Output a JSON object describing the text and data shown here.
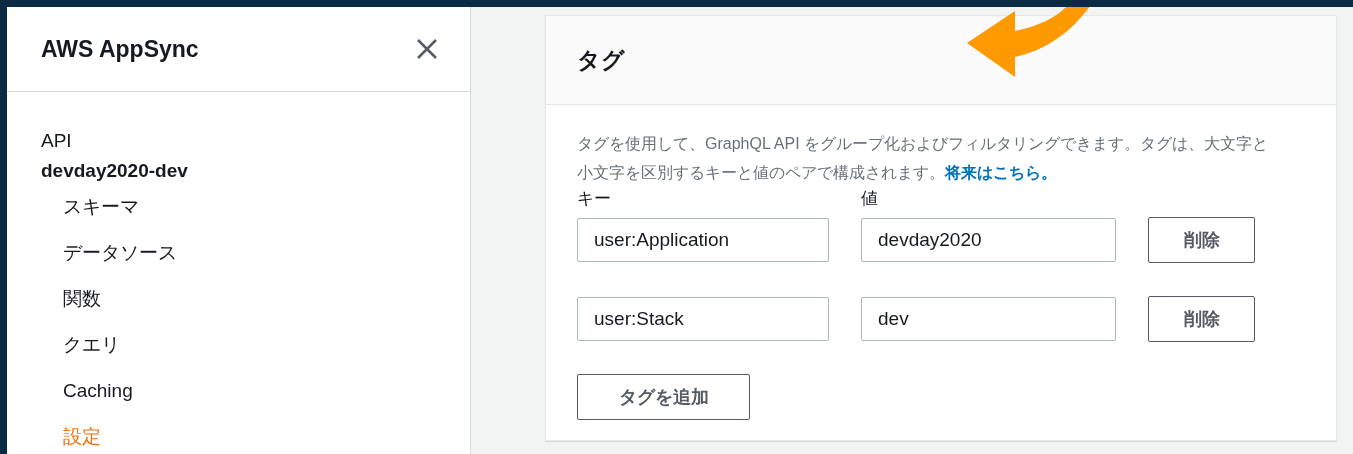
{
  "sidebar": {
    "title": "AWS AppSync",
    "items": [
      {
        "label": "API",
        "selected": false
      },
      {
        "label": "devday2020-dev",
        "selected": false,
        "children": [
          {
            "label": "スキーマ",
            "selected": false
          },
          {
            "label": "データソース",
            "selected": false
          },
          {
            "label": "関数",
            "selected": false
          },
          {
            "label": "クエリ",
            "selected": false
          },
          {
            "label": "Caching",
            "selected": false
          },
          {
            "label": "設定",
            "selected": true
          }
        ]
      }
    ]
  },
  "card": {
    "title": "タグ",
    "description": "タグを使用して、GraphQL API をグループ化およびフィルタリングできます。タグは、大文字と小文字を区別するキーと値のペアで構成されます。",
    "link": "将来はこちら。",
    "key_label": "キー",
    "value_label": "値",
    "tags": [
      {
        "key": "user:Application",
        "value": "devday2020",
        "remove_button": "削除"
      },
      {
        "key": "user:Stack",
        "value": "dev",
        "remove_button": "削除"
      }
    ],
    "add_button": "タグを追加"
  }
}
